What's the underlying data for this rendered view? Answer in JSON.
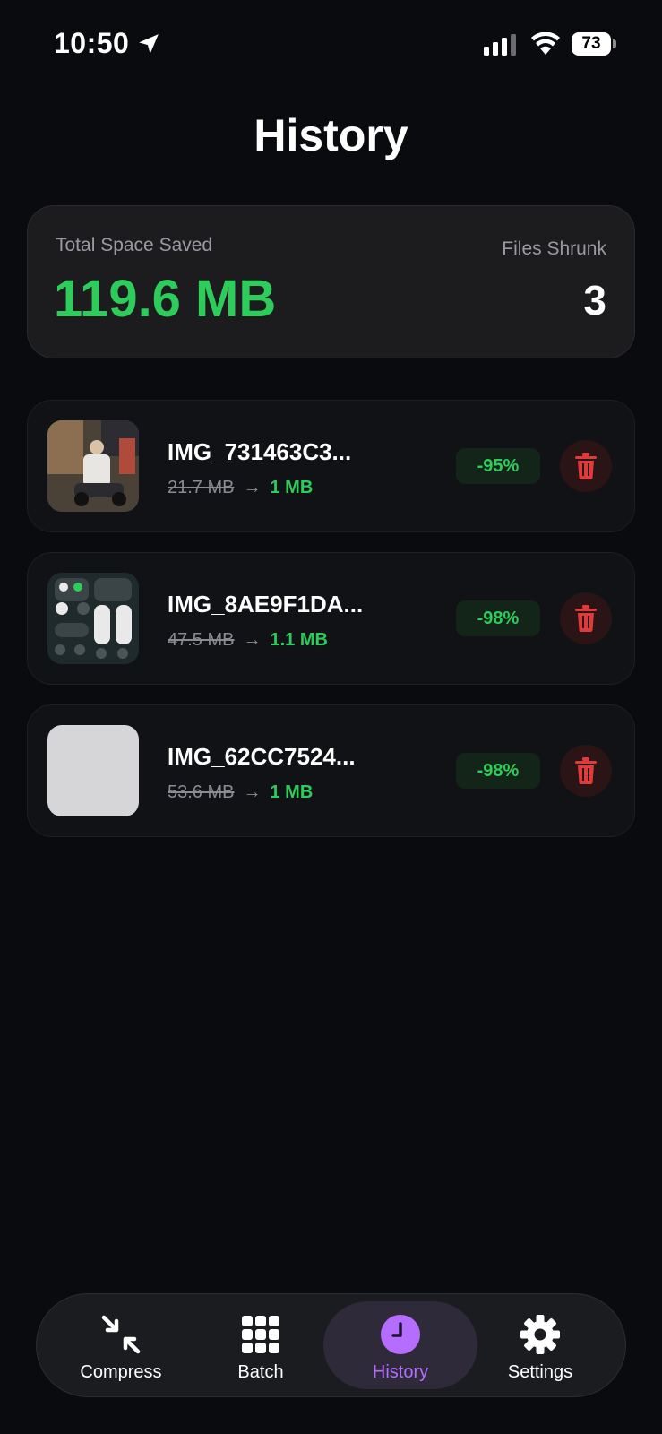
{
  "status": {
    "time": "10:50",
    "battery": "73"
  },
  "title": "History",
  "summary": {
    "space_label": "Total Space Saved",
    "space_value": "119.6 MB",
    "files_label": "Files Shrunk",
    "files_value": "3"
  },
  "items": [
    {
      "name": "IMG_731463C3...",
      "before": "21.7 MB",
      "arrow": "→",
      "after": "1 MB",
      "percent": "-95%"
    },
    {
      "name": "IMG_8AE9F1DA...",
      "before": "47.5 MB",
      "arrow": "→",
      "after": "1.1 MB",
      "percent": "-98%"
    },
    {
      "name": "IMG_62CC7524...",
      "before": "53.6 MB",
      "arrow": "→",
      "after": "1 MB",
      "percent": "-98%"
    }
  ],
  "tabs": [
    {
      "label": "Compress",
      "icon": "compress-icon"
    },
    {
      "label": "Batch",
      "icon": "grid-icon"
    },
    {
      "label": "History",
      "icon": "clock-icon",
      "active": true
    },
    {
      "label": "Settings",
      "icon": "gear-icon"
    }
  ],
  "colors": {
    "accent": "#b46dff",
    "success": "#2ecc5a",
    "danger": "#e03b3b",
    "background": "#0a0b0f"
  }
}
